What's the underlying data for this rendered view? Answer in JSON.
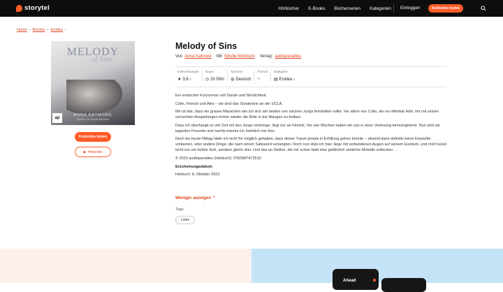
{
  "header": {
    "logo": "storytel",
    "nav": [
      "Hörbücher",
      "E-Books",
      "Bücherserien",
      "Kategorien"
    ],
    "login": "Einloggen",
    "cta": "Kostenlos testen"
  },
  "breadcrumb": [
    "Home",
    "Bücher",
    "Erotika"
  ],
  "cover": {
    "title": "MELODY",
    "script": "of Sins",
    "author": "ANNA KATMORE",
    "reader": "gelesen von Sibylle Nehrkorn",
    "publisher_badge": "ap"
  },
  "buttons": {
    "read": "Kostenlos testen",
    "sample": "Hörprobe"
  },
  "book": {
    "title": "Melody of Sins",
    "by_label": "Von",
    "author": "Anna Katmore",
    "with_label": "Mit",
    "narrator": "Sibylle Nehrkorn",
    "publisher_label": "Verlag:",
    "publisher": "audioparadies"
  },
  "meta": [
    {
      "label": "8 Bewertungen",
      "value": "3.6"
    },
    {
      "label": "Dauer",
      "value": "2h 50m"
    },
    {
      "label": "Sprache",
      "value": "Deutsch"
    },
    {
      "label": "Format",
      "value": ""
    },
    {
      "label": "Kategorie",
      "value": "Erotika"
    }
  ],
  "description": [
    "Ein erotischer Kurzroman voll Sünde und Sinnlichkeit.",
    "Colin, Finnick und Alex – sie sind das Sündentrio an der UCLA.",
    "Mir ist klar, dass ein graues Mäuschen wie ich sich am besten von solchen Jungs fernhalten sollte. Vor allem von Colin, der es offenbar liebt, mir mit seinen verruchten Anspielungen immer wieder die Röte in die Wangen zu treiben.",
    "Dass ich überhaupt so viel Zeit mit den Jungs verbringe, liegt nur an Finnick. Vor vier Wochen haben wir uns in einer Vorlesung kennengelernt. Nun sind wir tagsüber Freunde und nachts träume ich heimlich von ihm.",
    "Noch bis heute Mittag hätte ich nicht für möglich gehalten, dass dieser Traum jemals in Erfüllung gehen könnte – obwohl darin definitiv keine Eiswürfel vorkamen, oder andere Dinge, die nach einem Safeword verlangten. Doch nun sitze ich hier, liege mit verbundenen Augen auf seinem Esstisch, und mich küsst nicht nur ein heißer Kerl, sondern gleich drei. Und das an Stellen, die mir schon bald eine gefährlich sinnliche Melodie entlocken …",
    "© 2023 audioparadies (Hörbuch): 9783987472510"
  ],
  "release": {
    "heading": "Erscheinungsdatum",
    "value": "Hörbuch: 8. Oktober 2023"
  },
  "show_less": "Weniger anzeigen",
  "tags_label": "Tags",
  "tags": [
    "Liebe"
  ],
  "promo": {
    "phone_text": "Ahead"
  },
  "colors": {
    "accent": "#ff5c28",
    "link": "#e0441c",
    "header_bg": "#0d0d0d",
    "band_left": "#fdf0ec",
    "band_right": "#c4e3f7"
  }
}
